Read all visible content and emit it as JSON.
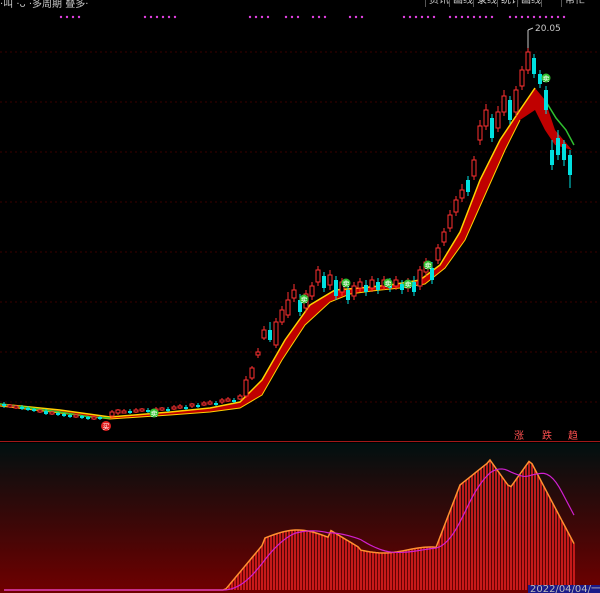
{
  "toolbar": {
    "title_fragment": "·叫 ·ᴗ ·多周期 叠多·",
    "buttons": [
      "资讯",
      "画线",
      "录线",
      "统计",
      "画线",
      "···",
      "帮忙"
    ]
  },
  "price_label": "20.05",
  "signals": {
    "lbl1": "涨",
    "lbl2": "跌",
    "lbl3": "趋"
  },
  "markers": {
    "buy": "买",
    "sell": "卖"
  },
  "date_label": "2022/04/04/一",
  "colors": {
    "up": "#ff3030",
    "down": "#00e0e0",
    "band": "#c00000",
    "band_edge": "#ffd000",
    "ma_green": "#30c030",
    "vol_bar": "#e02020",
    "vol_line1": "#ff9030",
    "vol_line2": "#d020d0"
  }
}
